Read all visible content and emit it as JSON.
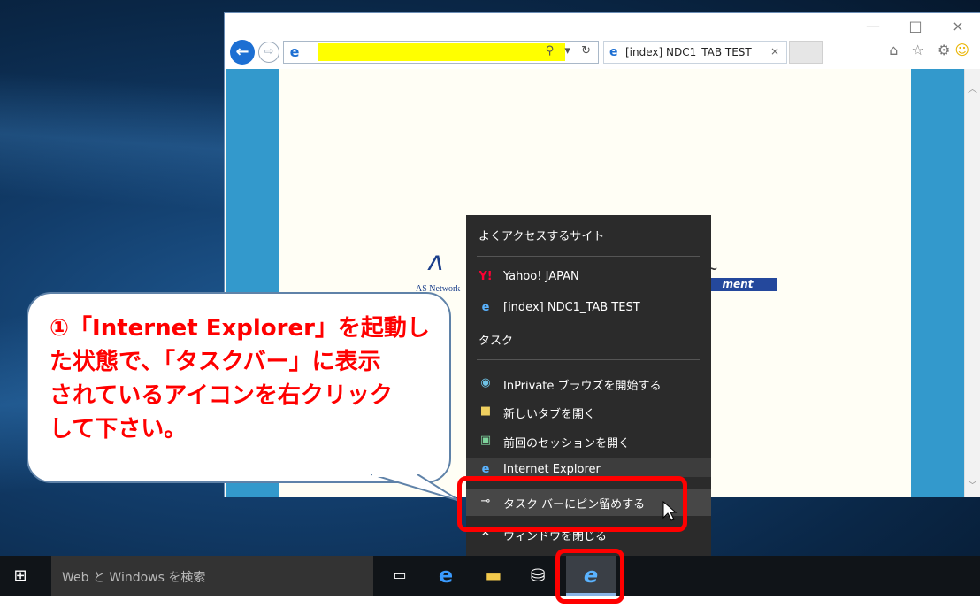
{
  "browser": {
    "tab_title": "[index] NDC1_TAB TEST",
    "tab_close": "×",
    "back": "←",
    "forward": "⇨",
    "addr_tools": "⚲ ▾ ↻",
    "win_min": "—",
    "win_max": "□",
    "win_close": "×",
    "toolbar_icons": "⌂ ☆ ⚙"
  },
  "page": {
    "logo_text": "AS Network",
    "banner_text": "ment",
    "tilde": "~"
  },
  "jumplist": {
    "frequent_header": "よくアクセスするサイト",
    "frequent_items": [
      {
        "icon": "yahoo-icon",
        "label": "Yahoo! JAPAN"
      },
      {
        "icon": "ie-page-icon",
        "label": "[index] NDC1_TAB TEST"
      }
    ],
    "tasks_header": "タスク",
    "task_items": [
      {
        "icon": "inprivate-icon",
        "label": "InPrivate ブラウズを開始する"
      },
      {
        "icon": "new-tab-icon",
        "label": "新しいタブを開く"
      },
      {
        "icon": "restore-session-icon",
        "label": "前回のセッションを開く"
      }
    ],
    "app_item": "Internet Explorer",
    "pin_item": "タスク バーにピン留めする",
    "close_item": "ウィンドウを閉じる"
  },
  "taskbar": {
    "search_placeholder": "Web と Windows を検索",
    "icons": [
      "task-view-icon",
      "edge-icon",
      "file-explorer-icon",
      "store-icon",
      "internet-explorer-icon"
    ]
  },
  "callout": {
    "line1": "①「Internet Explorer」を起動し",
    "line2": "た状態で、「タスクバー」に表示",
    "line3": "されているアイコンを右クリック",
    "line4": "して下さい。"
  },
  "colors": {
    "callout_text": "#ff0000",
    "highlight": "#ff0000",
    "jumplist_bg": "#2b2b2b",
    "taskbar_bg": "#101418"
  }
}
